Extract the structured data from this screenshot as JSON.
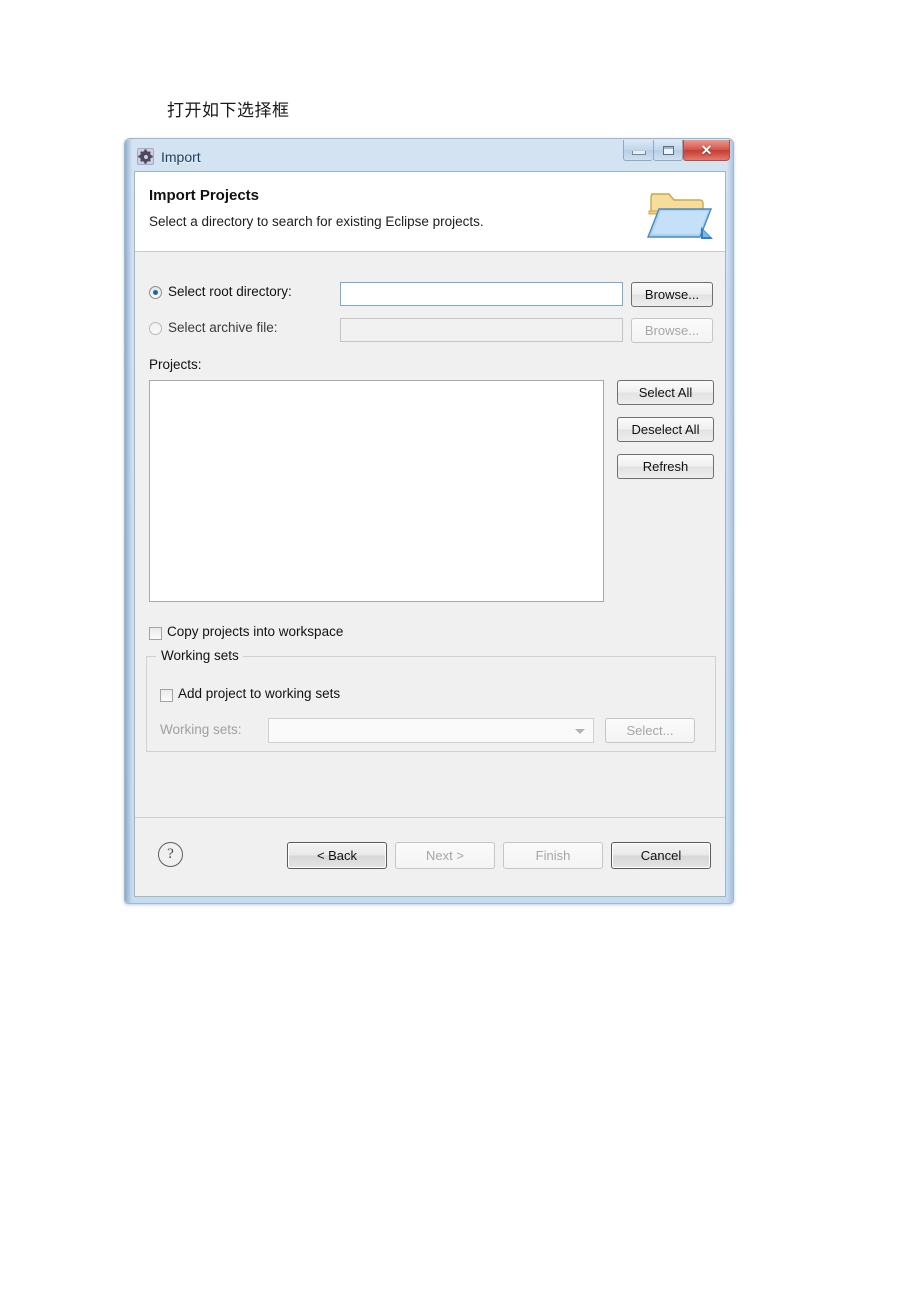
{
  "document": {
    "caption": "打开如下选择框"
  },
  "window": {
    "title": "Import",
    "icon": "gear-icon",
    "controls": {
      "minimize": "minimize-icon",
      "maximize": "maximize-icon",
      "close": "✕"
    }
  },
  "banner": {
    "title": "Import Projects",
    "subtitle": "Select a directory to search for existing Eclipse projects.",
    "icon": "open-folder-icon"
  },
  "source": {
    "root_directory": {
      "label": "Select root directory:",
      "selected": true,
      "value": "",
      "browse_label": "Browse...",
      "browse_enabled": true
    },
    "archive_file": {
      "label": "Select archive file:",
      "selected": false,
      "value": "",
      "browse_label": "Browse...",
      "browse_enabled": false
    }
  },
  "projects": {
    "label": "Projects:",
    "items": [],
    "buttons": [
      {
        "label": "Select All",
        "enabled": true
      },
      {
        "label": "Deselect All",
        "enabled": true
      },
      {
        "label": "Refresh",
        "enabled": true
      }
    ]
  },
  "options": {
    "copy_projects": {
      "label": "Copy projects into workspace",
      "checked": false
    }
  },
  "working_sets": {
    "legend": "Working sets",
    "add_checkbox": {
      "label": "Add project to working sets",
      "checked": false
    },
    "combo_label": "Working sets:",
    "combo_value": "",
    "select_button": "Select...",
    "enabled": false
  },
  "footer": {
    "help_glyph": "?",
    "buttons": [
      {
        "label": "< Back",
        "enabled": true,
        "default": true
      },
      {
        "label": "Next >",
        "enabled": false,
        "default": false
      },
      {
        "label": "Finish",
        "enabled": false,
        "default": false
      },
      {
        "label": "Cancel",
        "enabled": true,
        "default": true
      }
    ]
  },
  "colors": {
    "titlebar": "#cfe0f0",
    "dialog_bg": "#f0f0f0",
    "accent_blue": "#1c68b0",
    "close_red": "#c33d31",
    "folder_yellow": "#f5d98a",
    "folder_blue": "#85b9e8"
  }
}
